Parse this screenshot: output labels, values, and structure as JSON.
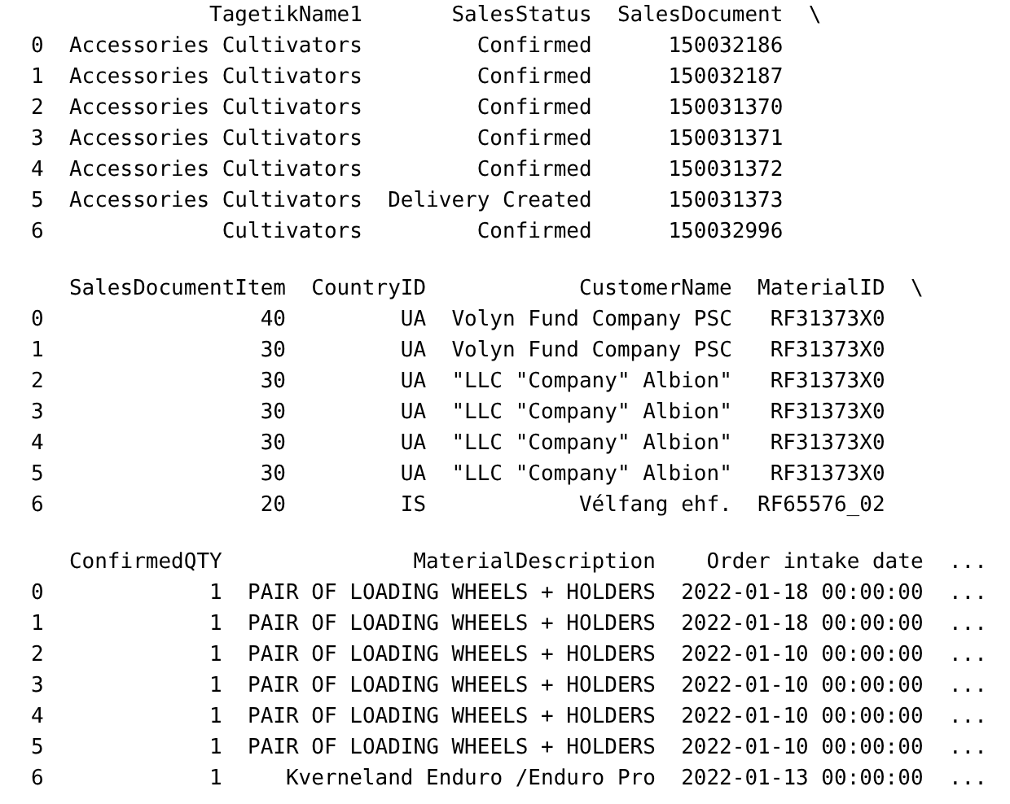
{
  "blocks": [
    {
      "columns": [
        "TagetikName1",
        "SalesStatus",
        "SalesDocument"
      ],
      "continuation": "\\",
      "rows": [
        {
          "index": "0",
          "cells": [
            "Accessories Cultivators",
            "Confirmed",
            "150032186"
          ]
        },
        {
          "index": "1",
          "cells": [
            "Accessories Cultivators",
            "Confirmed",
            "150032187"
          ]
        },
        {
          "index": "2",
          "cells": [
            "Accessories Cultivators",
            "Confirmed",
            "150031370"
          ]
        },
        {
          "index": "3",
          "cells": [
            "Accessories Cultivators",
            "Confirmed",
            "150031371"
          ]
        },
        {
          "index": "4",
          "cells": [
            "Accessories Cultivators",
            "Confirmed",
            "150031372"
          ]
        },
        {
          "index": "5",
          "cells": [
            "Accessories Cultivators",
            "Delivery Created",
            "150031373"
          ]
        },
        {
          "index": "6",
          "cells": [
            "Cultivators",
            "Confirmed",
            "150032996"
          ]
        }
      ]
    },
    {
      "columns": [
        "SalesDocumentItem",
        "CountryID",
        "CustomerName",
        "MaterialID"
      ],
      "continuation": "\\",
      "rows": [
        {
          "index": "0",
          "cells": [
            "40",
            "UA",
            "Volyn Fund Company PSC",
            "RF31373X0"
          ]
        },
        {
          "index": "1",
          "cells": [
            "30",
            "UA",
            "Volyn Fund Company PSC",
            "RF31373X0"
          ]
        },
        {
          "index": "2",
          "cells": [
            "30",
            "UA",
            "\"LLC \"Company\" Albion\"",
            "RF31373X0"
          ]
        },
        {
          "index": "3",
          "cells": [
            "30",
            "UA",
            "\"LLC \"Company\" Albion\"",
            "RF31373X0"
          ]
        },
        {
          "index": "4",
          "cells": [
            "30",
            "UA",
            "\"LLC \"Company\" Albion\"",
            "RF31373X0"
          ]
        },
        {
          "index": "5",
          "cells": [
            "30",
            "UA",
            "\"LLC \"Company\" Albion\"",
            "RF31373X0"
          ]
        },
        {
          "index": "6",
          "cells": [
            "20",
            "IS",
            "Vélfang ehf.",
            "RF65576_02"
          ]
        }
      ]
    },
    {
      "columns": [
        "ConfirmedQTY",
        "MaterialDescription",
        "Order intake date",
        "..."
      ],
      "rows": [
        {
          "index": "0",
          "cells": [
            "1",
            "PAIR OF LOADING WHEELS + HOLDERS",
            "2022-01-18 00:00:00",
            "..."
          ]
        },
        {
          "index": "1",
          "cells": [
            "1",
            "PAIR OF LOADING WHEELS + HOLDERS",
            "2022-01-18 00:00:00",
            "..."
          ]
        },
        {
          "index": "2",
          "cells": [
            "1",
            "PAIR OF LOADING WHEELS + HOLDERS",
            "2022-01-10 00:00:00",
            "..."
          ]
        },
        {
          "index": "3",
          "cells": [
            "1",
            "PAIR OF LOADING WHEELS + HOLDERS",
            "2022-01-10 00:00:00",
            "..."
          ]
        },
        {
          "index": "4",
          "cells": [
            "1",
            "PAIR OF LOADING WHEELS + HOLDERS",
            "2022-01-10 00:00:00",
            "..."
          ]
        },
        {
          "index": "5",
          "cells": [
            "1",
            "PAIR OF LOADING WHEELS + HOLDERS",
            "2022-01-10 00:00:00",
            "..."
          ]
        },
        {
          "index": "6",
          "cells": [
            "1",
            "Kverneland Enduro /Enduro Pro",
            "2022-01-13 00:00:00",
            "..."
          ]
        }
      ]
    }
  ]
}
